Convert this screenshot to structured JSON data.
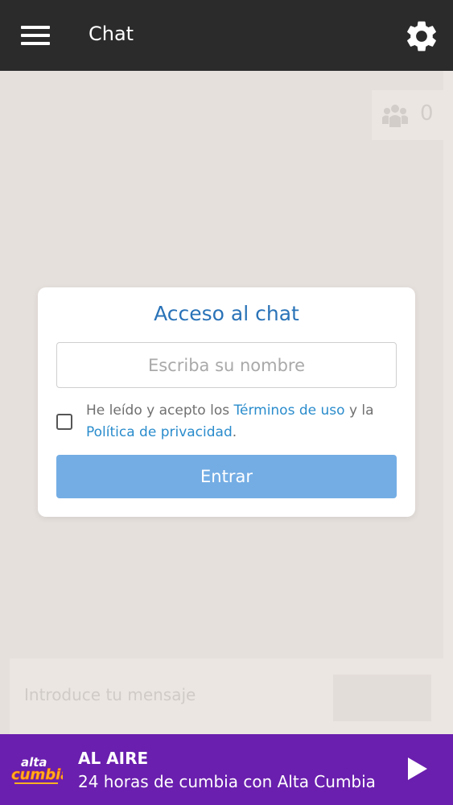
{
  "header": {
    "title": "Chat",
    "menu_icon": "hamburger-menu-icon",
    "settings_icon": "gear-icon"
  },
  "chat": {
    "users_count": "0",
    "users_icon": "users-group-icon",
    "message_placeholder": "Introduce tu mensaje"
  },
  "modal": {
    "title": "Acceso al chat",
    "name_placeholder": "Escriba su nombre",
    "terms_prefix": "He leído y acepto los ",
    "terms_link": "Términos de uso",
    "terms_middle": " y la ",
    "privacy_link": "Política de privacidad",
    "terms_suffix": ".",
    "enter_label": "Entrar"
  },
  "player": {
    "status": "AL AIRE",
    "track": "24 horas de cumbia con Alta Cumbia",
    "logo_text_1": "alta",
    "logo_text_2": "cumbia",
    "play_icon": "play-icon"
  },
  "colors": {
    "topbar": "#2b2b2b",
    "background": "#e6e0dc",
    "accent_blue": "#2a73b8",
    "link_blue": "#2a8ccc",
    "button_blue": "#74ade4",
    "player_purple": "#6a1fae"
  }
}
